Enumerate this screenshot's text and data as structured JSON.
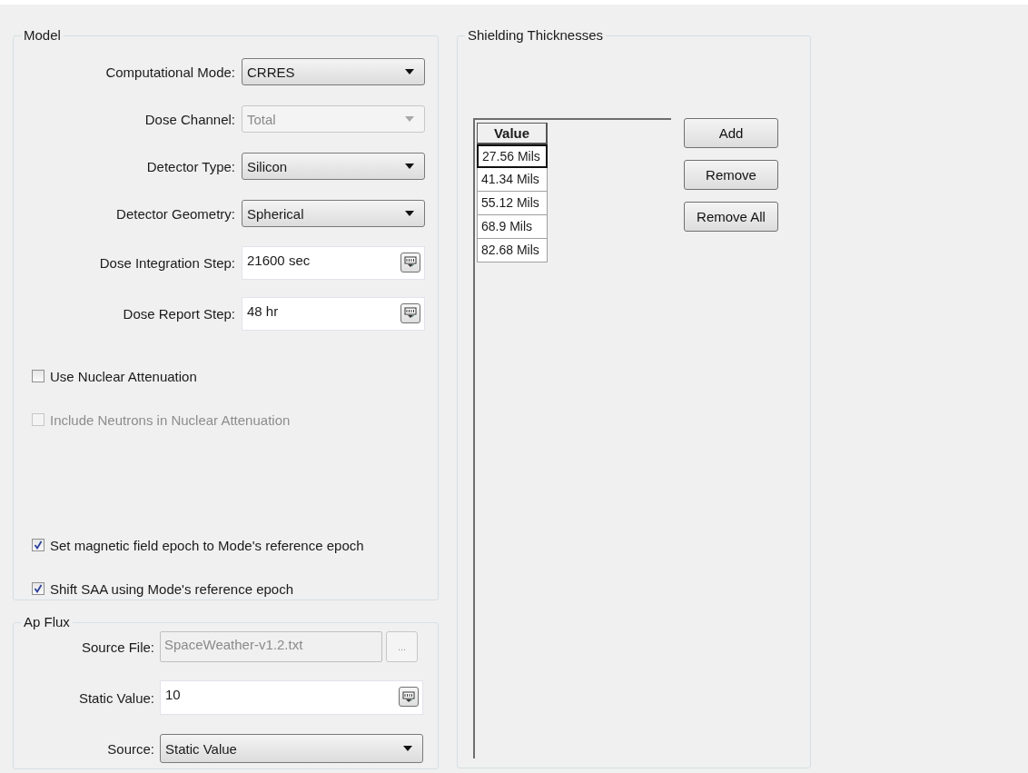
{
  "model": {
    "title": "Model",
    "fields": [
      {
        "kind": "dropdown",
        "label": "Computational Mode:",
        "value": "CRRES",
        "disabled": false
      },
      {
        "kind": "dropdown",
        "label": "Dose Channel:",
        "value": "Total",
        "disabled": true
      },
      {
        "kind": "dropdown",
        "label": "Detector Type:",
        "value": "Silicon",
        "disabled": false
      },
      {
        "kind": "dropdown",
        "label": "Detector Geometry:",
        "value": "Spherical",
        "disabled": false
      },
      {
        "kind": "spin",
        "label": "Dose Integration Step:",
        "value": "21600 sec",
        "disabled": false
      },
      {
        "kind": "spin",
        "label": "Dose Report Step:",
        "value": "48 hr",
        "disabled": false
      }
    ],
    "options": [
      {
        "label": "Use Nuclear Attenuation",
        "checked": false,
        "disabled": false
      },
      {
        "label": "Include Neutrons in Nuclear Attenuation",
        "checked": false,
        "disabled": true
      },
      {
        "label": "Set magnetic field epoch to Mode's reference epoch",
        "checked": true,
        "disabled": false
      },
      {
        "label": "Shift SAA using Mode's reference epoch",
        "checked": true,
        "disabled": false
      }
    ]
  },
  "ap_flux": {
    "title": "Ap Flux",
    "fields": [
      {
        "kind": "file",
        "label": "Source File:",
        "value": "SpaceWeather-v1.2.txt",
        "button": "...",
        "disabled": true
      },
      {
        "kind": "spin",
        "label": "Static Value:",
        "value": "10",
        "disabled": false
      },
      {
        "kind": "dropdown",
        "label": "Source:",
        "value": "Static Value",
        "disabled": false
      }
    ]
  },
  "shielding": {
    "title": "Shielding Thicknesses",
    "table": {
      "columns": [
        "Value"
      ],
      "rows": [
        {
          "value": "27.56 Mils",
          "selected": true
        },
        {
          "value": "41.34 Mils",
          "selected": false
        },
        {
          "value": "55.12 Mils",
          "selected": false
        },
        {
          "value": "68.9 Mils",
          "selected": false
        },
        {
          "value": "82.68 Mils",
          "selected": false
        }
      ]
    },
    "buttons": [
      "Add",
      "Remove",
      "Remove All"
    ]
  }
}
